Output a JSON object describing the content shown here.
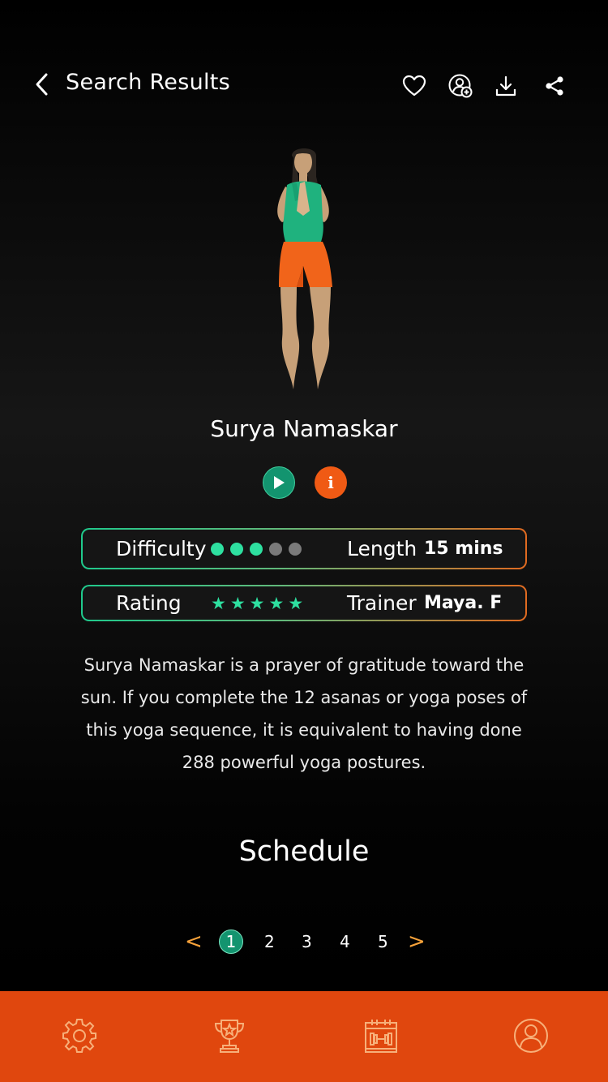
{
  "header": {
    "back_label": "Search Results",
    "icons": [
      "chevron-left-icon",
      "heart-icon",
      "add-user-icon",
      "download-icon",
      "share-icon"
    ]
  },
  "workout": {
    "title": "Surya Namaskar",
    "difficulty_label": "Difficulty",
    "difficulty_level": 3,
    "difficulty_max": 5,
    "length_label": "Length",
    "length_value": "15 mins",
    "rating_label": "Rating",
    "rating_stars": 5,
    "trainer_label": "Trainer",
    "trainer_value": "Maya. F",
    "description": "Surya Namaskar is a prayer of gratitude toward the sun.  If you complete the 12 asanas or yoga poses of this yoga sequence, it is equivalent to having done 288 powerful yoga postures."
  },
  "schedule": {
    "title": "Schedule",
    "pages": [
      "1",
      "2",
      "3",
      "4",
      "5"
    ],
    "current_page": "1",
    "prev_symbol": "<",
    "next_symbol": ">"
  },
  "tabbar": {
    "icons": [
      "gear-icon",
      "trophy-icon",
      "calendar-dumbbell-icon",
      "user-icon"
    ]
  },
  "colors": {
    "accent_green": "#13946f",
    "accent_orange": "#e0470e",
    "star_green": "#2ee0a0",
    "dot_inactive": "#7a7a7a"
  }
}
